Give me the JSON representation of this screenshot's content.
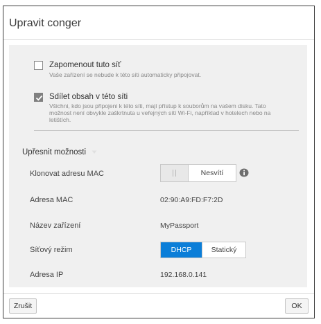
{
  "dialog": {
    "title": "Upravit conger"
  },
  "options": {
    "forget": {
      "title": "Zapomenout tuto síť",
      "description": "Vaše zařízení se nebude k této síti automaticky připojovat.",
      "checked": false
    },
    "share": {
      "title": "Sdílet obsah v této síti",
      "description_lines": [
        "Všichni, kdo jsou připojeni k této síti, mají přístup k souborům na vašem disku. Tato",
        "možnost není obvykle zaškrtnuta u veřejných sítí Wi-Fi, například v hotelech nebo na",
        "letištích."
      ],
      "checked": true
    }
  },
  "advanced": {
    "label": "Upřesnit možnosti",
    "icon": "chevron-down-icon"
  },
  "settings": {
    "mac_clone": {
      "label": "Klonovat adresu MAC",
      "toggle_text": "Nesvítí",
      "info_icon": "info-icon"
    },
    "mac_address": {
      "label": "Adresa MAC",
      "value": "02:90:A9:FD:F7:2D"
    },
    "device_name": {
      "label": "Název zařízení",
      "value": "MyPassport"
    },
    "network_mode": {
      "label": "Síťový režim",
      "options": [
        "DHCP",
        "Statický"
      ],
      "selected": "DHCP"
    },
    "ip_address": {
      "label": "Adresa IP",
      "value": "192.168.0.141"
    }
  },
  "footer": {
    "cancel_label": "Zrušit",
    "ok_label": "OK"
  },
  "colors": {
    "accent": "#0b7ed8",
    "panel_bg": "#f0f0f0"
  }
}
